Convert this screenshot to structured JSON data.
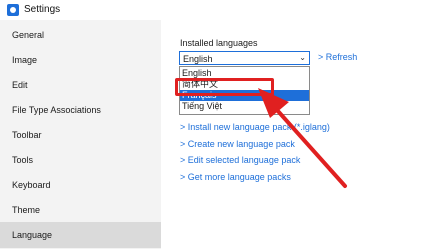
{
  "window": {
    "title": "Settings"
  },
  "sidebar": {
    "items": [
      {
        "label": "General"
      },
      {
        "label": "Image"
      },
      {
        "label": "Edit"
      },
      {
        "label": "File Type Associations"
      },
      {
        "label": "Toolbar"
      },
      {
        "label": "Tools"
      },
      {
        "label": "Keyboard"
      },
      {
        "label": "Theme"
      },
      {
        "label": "Language"
      }
    ],
    "active": "Language"
  },
  "language": {
    "label": "Installed languages",
    "selected": "English",
    "refresh_label": "> Refresh",
    "options": [
      "English",
      "简体中文",
      "Français",
      "Tiếng Việt"
    ],
    "highlighted_option": "Français",
    "links": [
      "> Install new language pack (*.iglang)",
      "> Create new language pack",
      "> Edit selected language pack",
      "> Get more language packs"
    ]
  },
  "colors": {
    "accent": "#1e6fd9",
    "annotation": "#e02020"
  }
}
